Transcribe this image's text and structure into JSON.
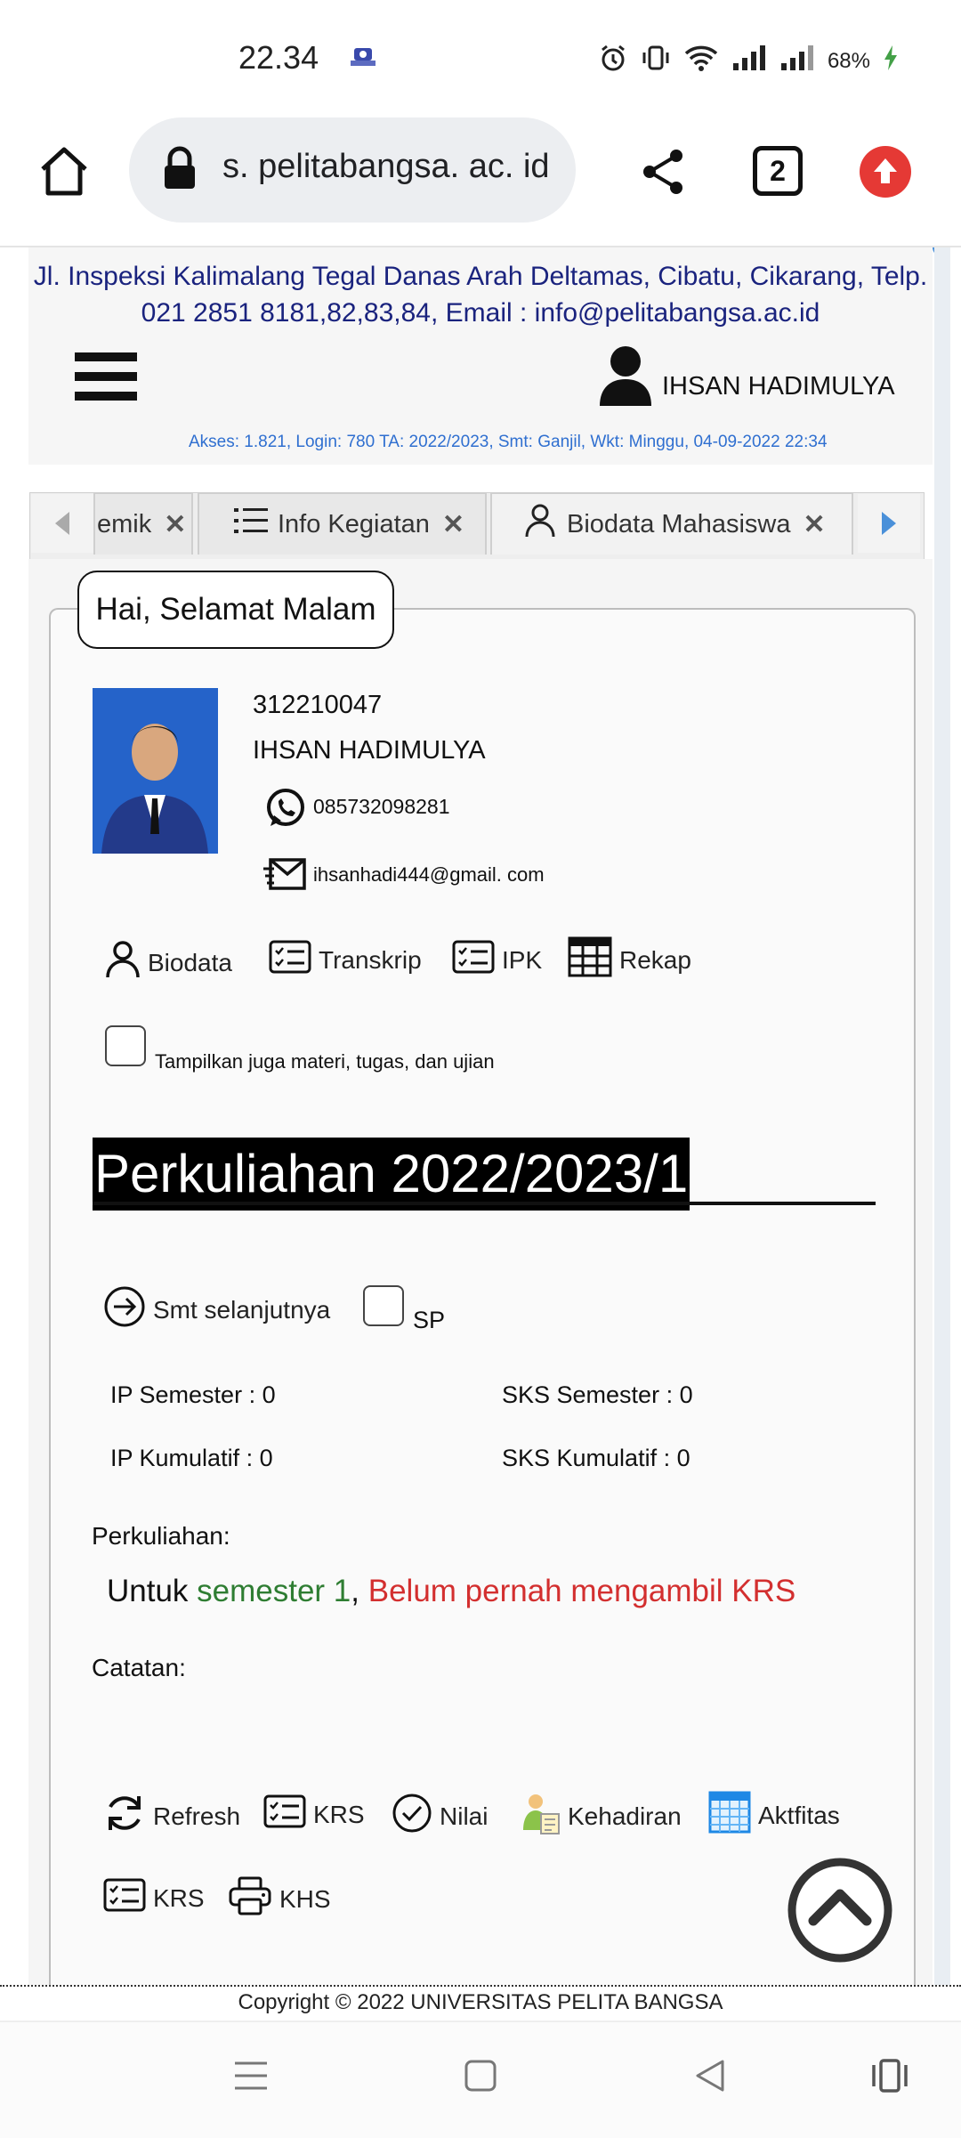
{
  "status_bar": {
    "time": "22.34",
    "battery": "68%"
  },
  "browser": {
    "url": "s. pelitabangsa. ac. id",
    "tab_count": "2"
  },
  "header": {
    "address_line1": "Jl. Inspeksi Kalimalang Tegal Danas Arah Deltamas, Cibatu, Cikarang, Telp.",
    "address_line2": "021 2851 8181,82,83,84, Email : info@pelitabangsa.ac.id",
    "user_name": "IHSAN HADIMULYA",
    "access_info": "Akses: 1.821, Login: 780 TA: 2022/2023, Smt: Ganjil, Wkt: Minggu, 04-09-2022 22:34"
  },
  "tabs": [
    {
      "label": "emik"
    },
    {
      "label": "Info Kegiatan"
    },
    {
      "label": "Biodata Mahasiswa"
    }
  ],
  "greeting": "Hai, Selamat Malam",
  "student": {
    "nim": "312210047",
    "name": "IHSAN HADIMULYA",
    "phone": "085732098281",
    "email": "ihsanhadi444@gmail. com"
  },
  "profile_links": {
    "biodata": "Biodata",
    "transkrip": "Transkrip",
    "ipk": "IPK",
    "rekap": "Rekap"
  },
  "show_materials_label": "Tampilkan juga materi,  tugas,  dan ujian",
  "semester_heading": "Perkuliahan 2022/2023/1",
  "next_semester_label": "Smt selanjutnya",
  "sp_label": "SP",
  "stats": {
    "ip_semester": "IP Semester : 0",
    "sks_semester": "SKS Semester : 0",
    "ip_kumulatif": "IP Kumulatif : 0",
    "sks_kumulatif": "SKS Kumulatif : 0"
  },
  "perkuliahan_label": "Perkuliahan:",
  "krs_message": {
    "prefix": "Untuk ",
    "semester": "semester 1",
    "comma": ", ",
    "status": "Belum pernah mengambil KRS"
  },
  "catatan_label": "Catatan:",
  "actions": {
    "refresh": "Refresh",
    "krs": "KRS",
    "nilai": "Nilai",
    "kehadiran": "Kehadiran",
    "aktifitas": "Aktfitas",
    "krs2": "KRS",
    "khs": "KHS"
  },
  "footer": {
    "copyright": "Copyright © 2022 UNIVERSITAS PELITA BANGSA"
  },
  "colors": {
    "address": "#1a237e",
    "access": "#2f6fd0",
    "semester_green": "#2e7d32",
    "krs_red": "#d32f2f",
    "upload_red": "#e53935"
  }
}
